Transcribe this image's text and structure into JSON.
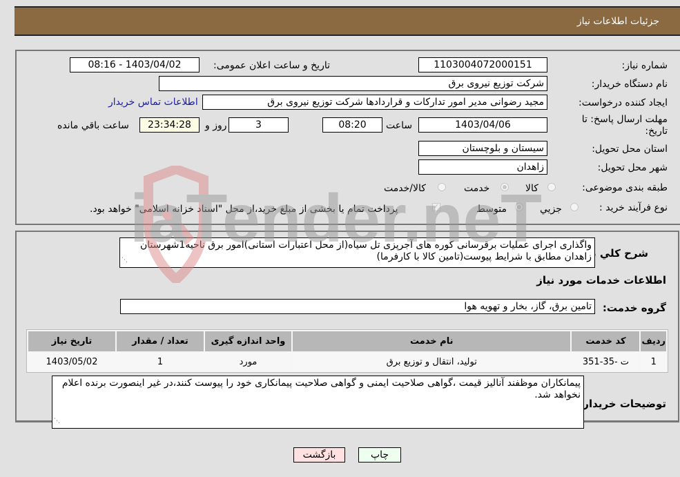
{
  "header": {
    "title": "جزئیات اطلاعات نیاز"
  },
  "form": {
    "need_number": {
      "label": "شماره نیاز:",
      "value": "1103004072000151"
    },
    "announce": {
      "label": "تاریخ و ساعت اعلان عمومی:",
      "value": "1403/04/02 - 08:16"
    },
    "buyer_org": {
      "label": "نام دستگاه خریدار:",
      "value": "شرکت توزیع نیروی برق"
    },
    "requester": {
      "label": "ایجاد کننده درخواست:",
      "value": "مجید  رضوانی مدیر امور تدارکات و قراردادها شرکت توزیع نیروی برق",
      "contact_link": "اطلاعات تماس خریدار"
    },
    "deadline": {
      "label_line1": "مهلت ارسال پاسخ: تا",
      "label_line2": "تاریخ:",
      "date": "1403/04/06",
      "time_label": "ساعت",
      "time": "08:20",
      "days": "3",
      "days_label": "روز و",
      "remaining": "23:34:28",
      "remaining_label": "ساعت باقي مانده"
    },
    "province": {
      "label": "استان محل تحویل:",
      "value": "سیستان و بلوچستان"
    },
    "city": {
      "label": "شهر محل تحویل:",
      "value": "زاهدان"
    },
    "category": {
      "label": "طبقه بندی موضوعی:",
      "options": [
        "کالا",
        "خدمت",
        "کالا/خدمت"
      ],
      "selected": "خدمت"
    },
    "purchase_type": {
      "label": "نوع فرآیند خرید :",
      "options": [
        "جزیي",
        "متوسط"
      ],
      "selected": "متوسط",
      "treasury_checkbox_label": "پرداخت تمام یا بخشی از مبلغ خرید،از محل \"اسناد خزانه اسلامی\" خواهد بود.",
      "treasury_checked": true
    }
  },
  "details": {
    "description_label": "شرح کلي نیاز:",
    "description": "واگذاری اجرای عملیات برقرسانی کوره های آجرپزی تل سیاه(از محل اعتبارات استانی)امور برق ناحیه1شهرستان زاهدان مطابق با شرایط پیوست(تامین کالا با کارفرما)",
    "services_title": "اطلاعات خدمات مورد نیاز",
    "service_group_label": "گروه خدمت:",
    "service_group": "تامین برق، گاز، بخار و تهویه هوا",
    "table": {
      "headers": [
        "ردیف",
        "کد خدمت",
        "نام خدمت",
        "واحد اندازه گیری",
        "تعداد / مقدار",
        "تاریخ نیاز"
      ],
      "rows": [
        [
          "1",
          "ت -35-351",
          "تولید، انتقال و توزیع برق",
          "مورد",
          "1",
          "1403/05/02"
        ]
      ]
    },
    "buyer_notes_label": "توضیحات خریدار:",
    "buyer_notes": "پیمانکاران موظفند آنالیز قیمت ،گواهی صلاحیت ایمنی و گواهی صلاحیت پیمانکاری خود را پیوست کنند،در غیر اینصورت برنده اعلام نخواهد شد."
  },
  "buttons": {
    "print": "چاپ",
    "back": "بازگشت"
  },
  "watermark": {
    "text": "AriaTender.neT"
  },
  "colors": {
    "header_bg": "#8b6a42",
    "remaining_bg": "#fdfde6",
    "print_bg": "#efffef",
    "back_bg": "#ffe1e1",
    "link": "#1a1aa6"
  }
}
